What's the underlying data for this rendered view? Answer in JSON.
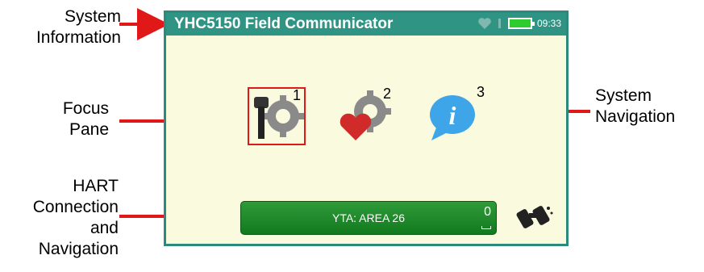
{
  "callouts": {
    "system_information": "System\nInformation",
    "focus_pane": "Focus\nPane",
    "system_navigation": "System\nNavigation",
    "hart_connection": "HART\nConnection\nand\nNavigation"
  },
  "device": {
    "title": "YHC5150 Field Communicator",
    "time": "09:33",
    "tiles": [
      {
        "number": "1",
        "icon": "device-gear-icon"
      },
      {
        "number": "2",
        "icon": "heart-gear-icon"
      },
      {
        "number": "3",
        "icon": "info-bubble-icon"
      }
    ],
    "hart": {
      "label": "YTA: AREA 26",
      "count": "0"
    }
  },
  "colors": {
    "accent": "#2f9484",
    "focus": "#e01818",
    "button": "#1e8a2a",
    "arrow": "#e01818"
  }
}
